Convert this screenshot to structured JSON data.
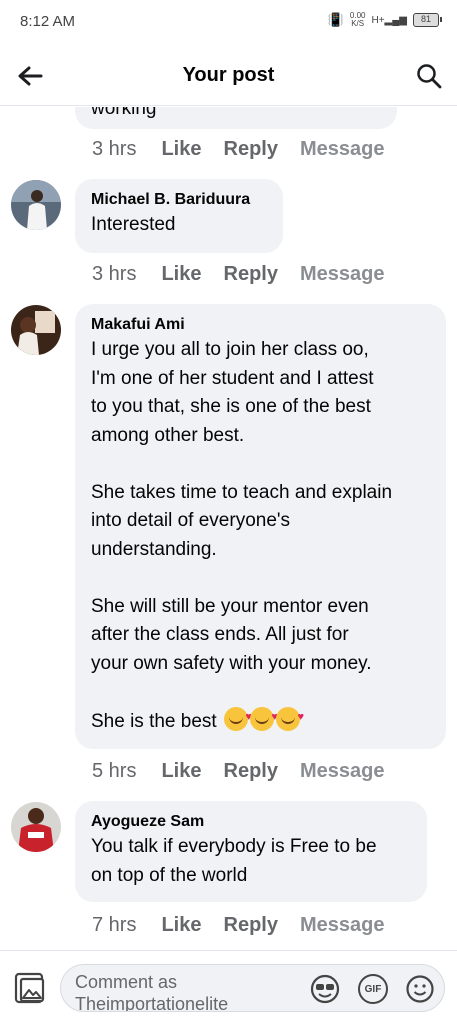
{
  "status_bar": {
    "time": "8:12 AM",
    "net_speed": "0.00",
    "net_unit": "K/S",
    "network": "H+",
    "battery": "81"
  },
  "header": {
    "title": "Your post",
    "back_icon": "arrow-left-icon",
    "search_icon": "search-icon"
  },
  "comments": [
    {
      "name": "",
      "text": "working",
      "time": "3 hrs",
      "like": "Like",
      "reply": "Reply",
      "message": "Message"
    },
    {
      "name": "Michael B. Bariduura",
      "text": "Interested",
      "time": "3 hrs",
      "like": "Like",
      "reply": "Reply",
      "message": "Message"
    },
    {
      "name": "Makafui Ami",
      "text": "I urge you all to join her class oo,\nI'm one of her student and I attest\nto you that, she is one of the best\namong other best.\n\nShe takes time to teach and explain\ninto detail of everyone's\nunderstanding.\n\nShe will still be your mentor even\nafter the class ends. All just for\nyour own safety with your money.\n\nShe is the best",
      "emoji": "smiling-face-with-hearts",
      "emoji_count": 3,
      "time": "5 hrs",
      "like": "Like",
      "reply": "Reply",
      "message": "Message"
    },
    {
      "name": "Ayogueze Sam",
      "text": "You talk if everybody is Free to be\non top of the world",
      "time": "7 hrs",
      "like": "Like",
      "reply": "Reply",
      "message": "Message"
    }
  ],
  "composer": {
    "placeholder": "Comment as Theimportationelite",
    "gif_label": "GIF",
    "photo_icon": "photo-icon",
    "sticker_icon": "sticker-icon",
    "emoji_icon": "emoji-icon"
  },
  "colors": {
    "bubble": "#f0f2f5",
    "secondary_text": "#65676b",
    "disabled_text": "#8a8d91"
  }
}
